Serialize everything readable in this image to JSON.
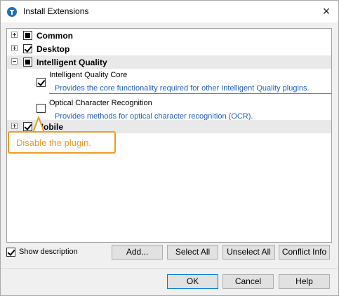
{
  "window": {
    "title": "Install Extensions",
    "close_glyph": "×"
  },
  "tree": {
    "items": [
      {
        "label": "Common",
        "expander": "+",
        "state": "partial"
      },
      {
        "label": "Desktop",
        "expander": "+",
        "state": "checked"
      },
      {
        "label": "Intelligent Quality",
        "expander": "-",
        "state": "partial"
      },
      {
        "label": "Intelligent Quality Core",
        "desc": "Provides the core functionality required for other Intelligent Quality plugins.",
        "state": "checked"
      },
      {
        "label": "Optical Character Recognition",
        "desc": "Provides methods for optical character recognition (OCR).",
        "state": "unchecked"
      },
      {
        "label": "Mobile",
        "expander": "+",
        "state": "checked"
      }
    ]
  },
  "callout": {
    "text": "Disable the plugin."
  },
  "options": {
    "show_description": "Show description"
  },
  "buttons": {
    "add": "Add...",
    "select_all": "Select All",
    "unselect_all": "Unselect All",
    "conflict_info": "Conflict Info",
    "ok": "OK",
    "cancel": "Cancel",
    "help": "Help"
  },
  "colors": {
    "callout": "#f29a22",
    "description_text": "#1f5fbf",
    "default_button_border": "#0078d7"
  }
}
